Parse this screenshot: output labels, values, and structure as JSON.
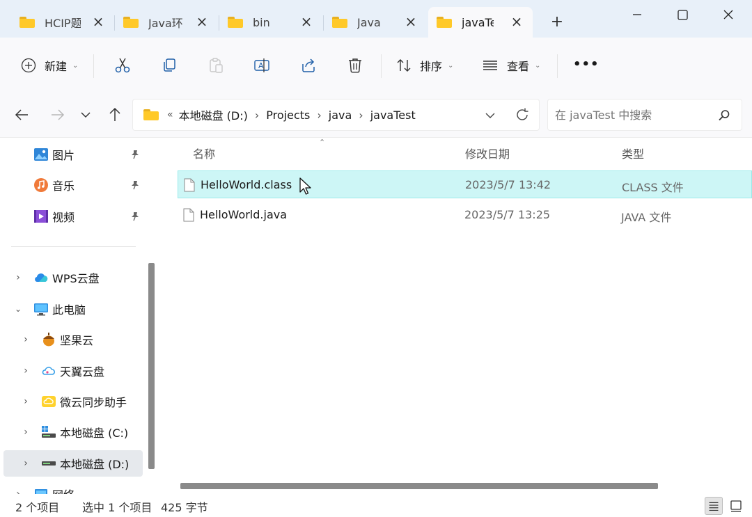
{
  "tabs": [
    {
      "label": "HCIP题"
    },
    {
      "label": "Java环"
    },
    {
      "label": "bin"
    },
    {
      "label": "Java"
    },
    {
      "label": "javaTest"
    }
  ],
  "toolbar": {
    "new_label": "新建",
    "sort_label": "排序",
    "view_label": "查看",
    "more_label": "•••"
  },
  "address": {
    "overflow": "«",
    "crumbs": [
      "本地磁盘 (D:)",
      "Projects",
      "java",
      "javaTest"
    ]
  },
  "search": {
    "placeholder": "在 javaTest 中搜索"
  },
  "sidebar": {
    "quick_access": [
      {
        "label": "图片",
        "icon": "pictures-icon"
      },
      {
        "label": "音乐",
        "icon": "music-icon"
      },
      {
        "label": "视频",
        "icon": "videos-icon"
      }
    ],
    "tree": [
      {
        "label": "WPS云盘",
        "icon": "wps-cloud-icon"
      },
      {
        "label": "此电脑",
        "icon": "this-pc-icon"
      },
      {
        "label": "坚果云",
        "icon": "jianguoyun-icon"
      },
      {
        "label": "天翼云盘",
        "icon": "tianyi-cloud-icon"
      },
      {
        "label": "微云同步助手",
        "icon": "weiyun-icon"
      },
      {
        "label": "本地磁盘 (C:)",
        "icon": "drive-c-icon"
      },
      {
        "label": "本地磁盘 (D:)",
        "icon": "drive-d-icon"
      },
      {
        "label": "网络",
        "icon": "network-icon"
      }
    ]
  },
  "columns": {
    "name": "名称",
    "date": "修改日期",
    "type": "类型"
  },
  "files": [
    {
      "name": "HelloWorld.class",
      "date": "2023/5/7 13:42",
      "type": "CLASS 文件"
    },
    {
      "name": "HelloWorld.java",
      "date": "2023/5/7 13:25",
      "type": "JAVA 文件"
    }
  ],
  "status": {
    "item_count": "2 个项目",
    "selection": "选中 1 个项目",
    "size": "425 字节"
  },
  "colors": {
    "tabbar_bg": "#e8f0f9",
    "toolbar_bg": "#f9f9fb",
    "selection_bg": "#cdf6f6",
    "selection_border": "#99ebeb",
    "folder": "#ffc929"
  }
}
